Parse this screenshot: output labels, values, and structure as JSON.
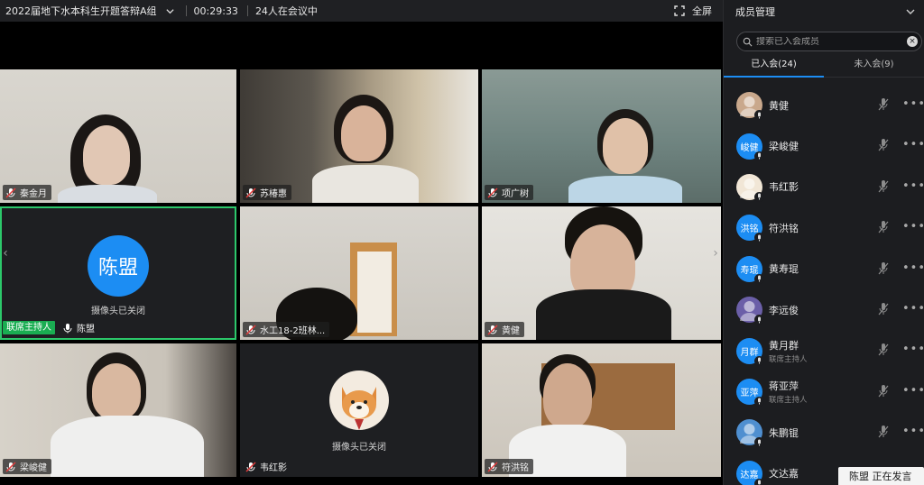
{
  "meeting": {
    "title": "2022届地下水本科生开题答辩A组",
    "duration": "00:29:33",
    "participants_status": "24人在会议中",
    "fullscreen_label": "全屏"
  },
  "tiles": [
    {
      "name": "秦金月"
    },
    {
      "name": "苏椿惠"
    },
    {
      "name": "项广树"
    },
    {
      "name": "陈盟",
      "avatar_text": "陈盟",
      "camera_off": "摄像头已关闭",
      "host_tag": "联席主持人"
    },
    {
      "name": "水工18-2班林..."
    },
    {
      "name": "黄健"
    },
    {
      "name": "梁峻健"
    },
    {
      "name": "韦红影",
      "camera_off": "摄像头已关闭"
    },
    {
      "name": "符洪铭"
    }
  ],
  "panel": {
    "title": "成员管理",
    "search_placeholder": "搜索已入会成员",
    "tabs": [
      {
        "label": "已入会(24)",
        "active": true
      },
      {
        "label": "未入会(9)",
        "active": false
      }
    ],
    "members": [
      {
        "name": "黄健",
        "avatar": "photo",
        "color": "#c9a88c"
      },
      {
        "name": "梁峻健",
        "avatar": "峻健",
        "color": "#1c8df3"
      },
      {
        "name": "韦红影",
        "avatar": "photo",
        "color": "#f1e6d6"
      },
      {
        "name": "符洪铭",
        "avatar": "洪铭",
        "color": "#1c8df3"
      },
      {
        "name": "黄寿琨",
        "avatar": "寿琨",
        "color": "#1c8df3"
      },
      {
        "name": "李远俊",
        "avatar": "photo",
        "color": "#6b5fa8"
      },
      {
        "name": "黄月群",
        "avatar": "月群",
        "color": "#1c8df3",
        "role": "联席主持人"
      },
      {
        "name": "蒋亚萍",
        "avatar": "亚萍",
        "color": "#1c8df3",
        "role": "联席主持人"
      },
      {
        "name": "朱鹏锟",
        "avatar": "photo",
        "color": "#4f8fd0"
      },
      {
        "name": "文达嘉",
        "avatar": "达嘉",
        "color": "#1c8df3"
      }
    ]
  },
  "toast": {
    "text": "陈盟  正在发言"
  },
  "colors": {
    "accent": "#1c8df3",
    "host_green": "#1aad52",
    "active_speaker": "#2cc86b"
  }
}
